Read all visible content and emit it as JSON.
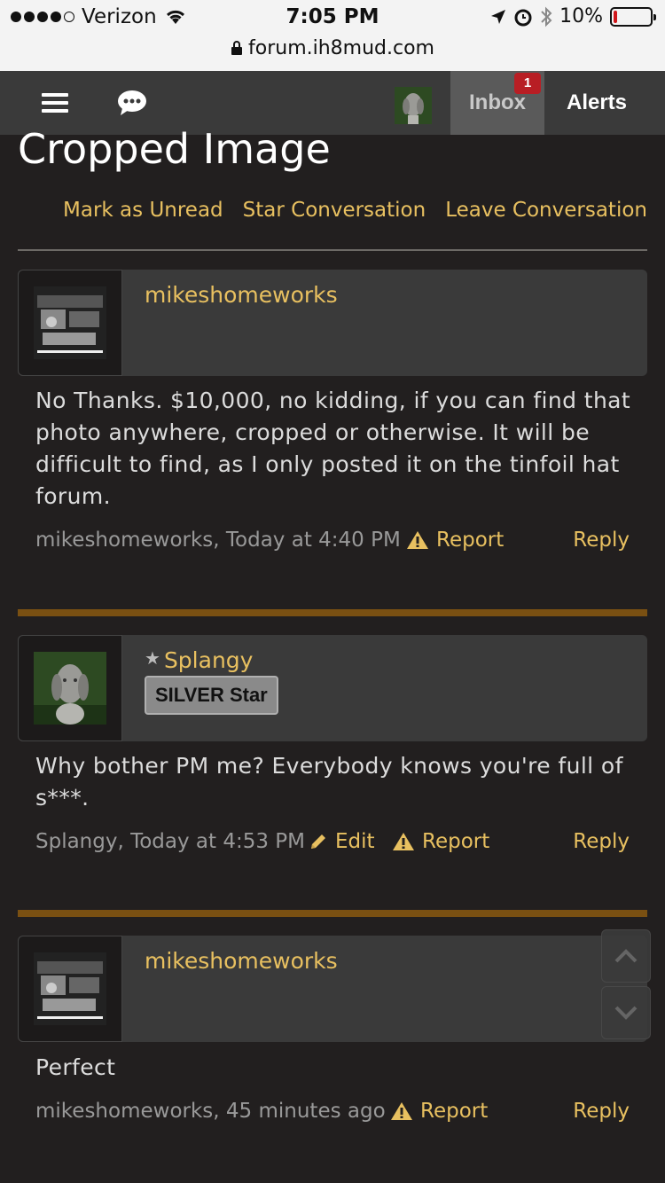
{
  "status_bar": {
    "carrier": "Verizon",
    "time": "7:05 PM",
    "battery": "10%",
    "battery_level": 0.1,
    "url": "forum.ih8mud.com"
  },
  "nav": {
    "inbox_label": "Inbox",
    "inbox_badge": "1",
    "alerts_label": "Alerts"
  },
  "page": {
    "title": "Cropped Image",
    "actions": [
      "Mark as Unread",
      "Star Conversation",
      "Leave Conversation"
    ]
  },
  "messages": [
    {
      "username": "mikeshomeworks",
      "body": "No Thanks. $10,000, no kidding, if you can find that photo anywhere, cropped or otherwise. It will be difficult to find, as I only posted it on the tinfoil hat forum.",
      "meta": "mikeshomeworks, Today at 4:40 PM",
      "report": "Report",
      "reply": "Reply"
    },
    {
      "username": "Splangy",
      "rank": "SILVER Star",
      "body": "Why bother PM me? Everybody knows you're full of s***.",
      "meta": "Splangy, Today at 4:53 PM",
      "edit": "Edit",
      "report": "Report",
      "reply": "Reply"
    },
    {
      "username": "mikeshomeworks",
      "body": "Perfect",
      "meta": "mikeshomeworks, 45 minutes ago",
      "report": "Report",
      "reply": "Reply"
    }
  ],
  "colors": {
    "accent": "#e8c060",
    "separator": "#7a5012",
    "badge": "#b81e24"
  }
}
